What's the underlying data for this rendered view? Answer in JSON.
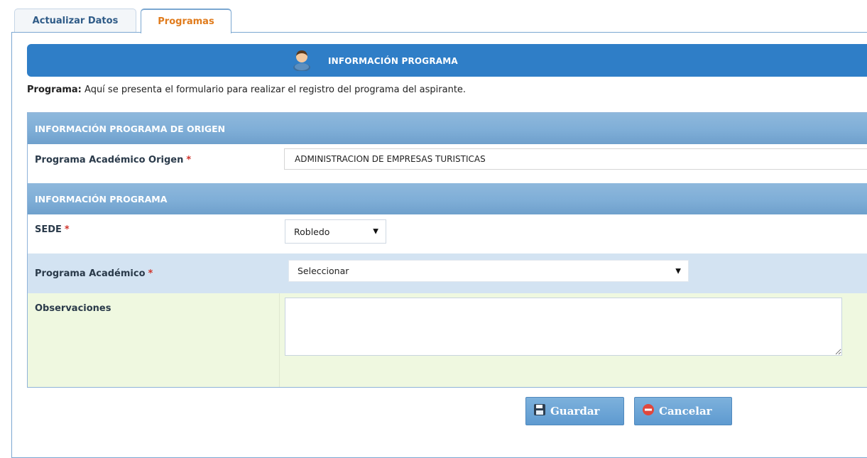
{
  "tabs": [
    {
      "label": "Actualizar Datos",
      "active": false
    },
    {
      "label": "Programas",
      "active": true
    }
  ],
  "header": {
    "title": "INFORMACIÓN PROGRAMA",
    "icon": "user-icon"
  },
  "description": {
    "bold": "Programa:",
    "text": " Aquí se presenta el formulario para realizar el registro del programa del aspirante."
  },
  "sections": {
    "origin": "INFORMACIÓN PROGRAMA DE ORIGEN",
    "program": "INFORMACIÓN PROGRAMA"
  },
  "fields": {
    "origin_program": {
      "label": "Programa Académico Origen",
      "required_mark": "*",
      "value": "ADMINISTRACION DE EMPRESAS TURISTICAS"
    },
    "sede": {
      "label": "SEDE",
      "required_mark": "*",
      "value": "Robledo"
    },
    "academic_program": {
      "label": "Programa Académico",
      "required_mark": "*",
      "value": "Seleccionar"
    },
    "observations": {
      "label": "Observaciones",
      "value": ""
    }
  },
  "buttons": {
    "save": {
      "label": "Guardar",
      "icon": "floppy-disk-icon"
    },
    "cancel": {
      "label": "Cancelar",
      "icon": "minus-circle-icon"
    }
  },
  "colors": {
    "header_bg": "#2f7ec7",
    "section_bg": "#7faed7",
    "row_blue": "#d3e3f2",
    "row_green": "#eff8e0",
    "active_tab_text": "#e07b1c",
    "required": "#d0342c"
  }
}
